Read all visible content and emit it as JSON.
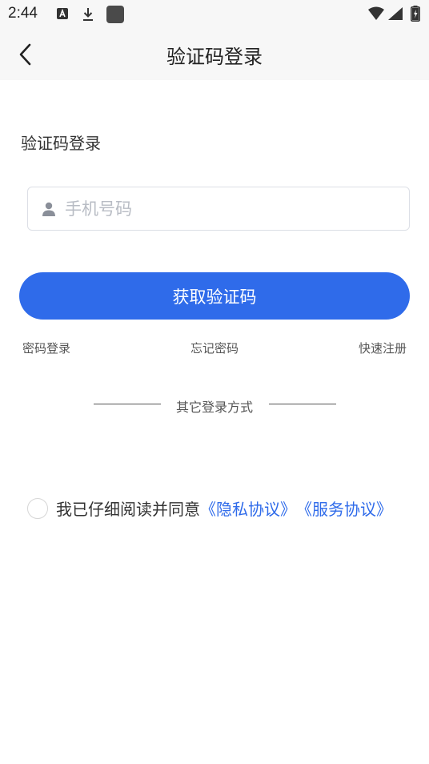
{
  "status_bar": {
    "time": "2:44",
    "icons": [
      "a-notification-icon",
      "download-icon",
      "app-icon",
      "wifi-icon",
      "signal-icon",
      "battery-charging-icon"
    ]
  },
  "nav": {
    "title": "验证码登录",
    "back_icon": "chevron-left-icon"
  },
  "form": {
    "section_title": "验证码登录",
    "phone_placeholder": "手机号码",
    "phone_value": "",
    "submit_label": "获取验证码"
  },
  "links": {
    "password_login": "密码登录",
    "forgot_password": "忘记密码",
    "quick_register": "快速注册"
  },
  "divider": {
    "text": "其它登录方式"
  },
  "agreement": {
    "text": "我已仔细阅读并同意",
    "privacy_link": "《隐私协议》",
    "service_link": "《服务协议》",
    "checked": false
  },
  "colors": {
    "accent": "#2f6bea",
    "bar_background": "#f7f7f7",
    "placeholder": "#b8bcc4"
  }
}
